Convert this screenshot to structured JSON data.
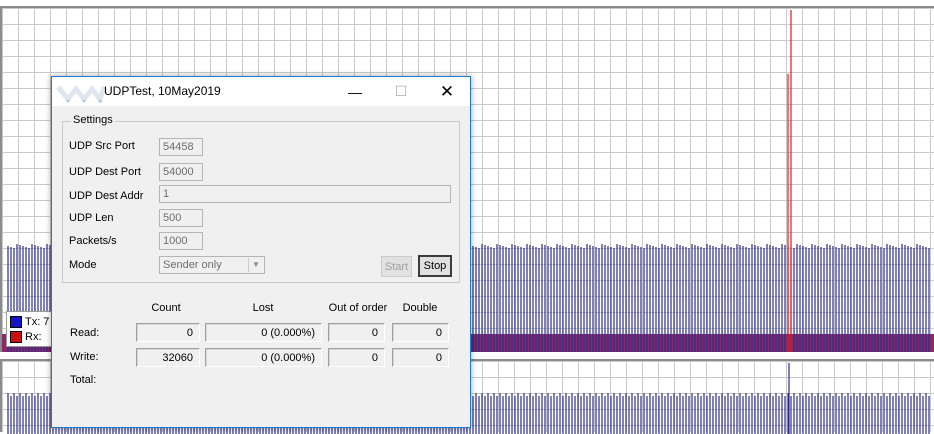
{
  "window": {
    "title": "UDPTest, 10May2019",
    "title_buttons": [
      "minimize",
      "maximize",
      "close"
    ]
  },
  "settings": {
    "group_title": "Settings",
    "src_port": {
      "label": "UDP Src Port",
      "value": "54458"
    },
    "dest_port": {
      "label": "UDP Dest Port",
      "value": "54000"
    },
    "dest_addr": {
      "label": "UDP Dest Addr",
      "value": "1"
    },
    "len": {
      "label": "UDP Len",
      "value": "500"
    },
    "packets": {
      "label": "Packets/s",
      "value": "1000"
    },
    "mode": {
      "label": "Mode",
      "value": "Sender only"
    },
    "start_label": "Start",
    "stop_label": "Stop"
  },
  "stats": {
    "headers": {
      "count": "Count",
      "lost": "Lost",
      "order": "Out of order",
      "double": "Double"
    },
    "rows": {
      "read": {
        "label": "Read:",
        "count": "0",
        "lost": "0 (0.000%)",
        "order": "0",
        "double": "0"
      },
      "write": {
        "label": "Write:",
        "count": "32060",
        "lost": "0 (0.000%)",
        "order": "0",
        "double": "0"
      },
      "total": {
        "label": "Total:"
      }
    }
  },
  "legend": {
    "tx": {
      "label": "Tx:",
      "value": "7",
      "color": "#1414c8"
    },
    "rx": {
      "label": "Rx:",
      "color": "#d01010"
    }
  },
  "colors": {
    "tx_bar": "#2a2a8c",
    "rx_fill": "#8b2a66",
    "spike": "#e01a1a",
    "accent": "#1e78d2"
  }
}
